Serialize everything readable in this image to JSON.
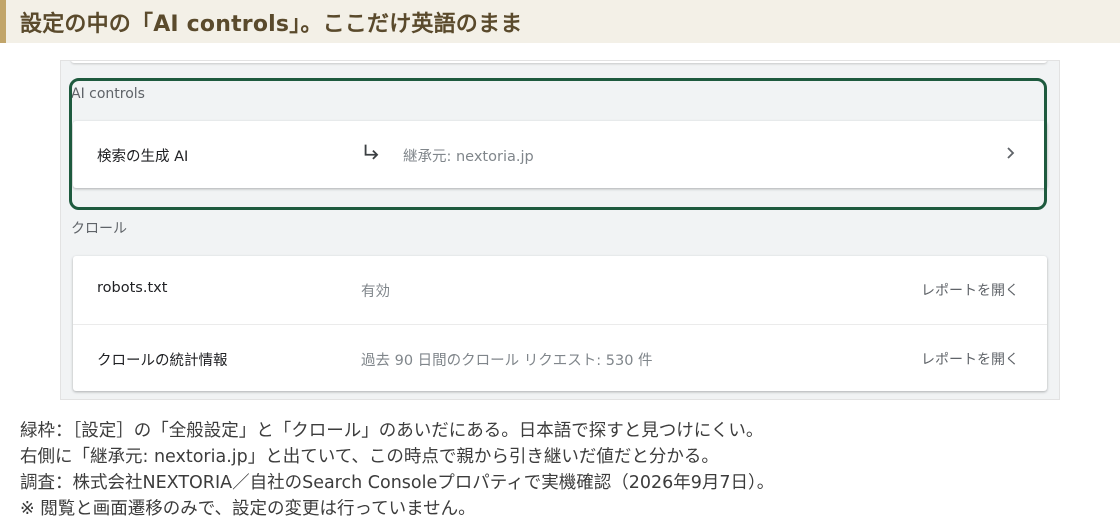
{
  "banner": {
    "title": "設定の中の「AI controls」。ここだけ英語のまま"
  },
  "screenshot": {
    "ai_section": {
      "label": "AI controls",
      "rows": [
        {
          "name": "検索の生成 AI",
          "value": "継承元: nextoria.jp",
          "icon": "subdirectory-arrow-icon",
          "action_icon": "chevron-right-icon"
        }
      ]
    },
    "crawl_section": {
      "label": "クロール",
      "rows": [
        {
          "name": "robots.txt",
          "value": "有効",
          "link": "レポートを開く"
        },
        {
          "name": "クロールの統計情報",
          "value": "過去 90 日間のクロール リクエスト: 530 件",
          "link": "レポートを開く"
        }
      ]
    },
    "highlight_color": "#1e5a3e"
  },
  "notes": {
    "line1": "緑枠：［設定］の「全般設定」と「クロール」のあいだにある。日本語で探すと見つけにくい。",
    "line2": "右側に「継承元: nextoria.jp」と出ていて、この時点で親から引き継いだ値だと分かる。",
    "line3": "調査：株式会社NEXTORIA／自社のSearch Consoleプロパティで実機確認（2026年9月7日）。",
    "line4": "※ 閲覧と画面遷移のみで、設定の変更は行っていません。"
  }
}
